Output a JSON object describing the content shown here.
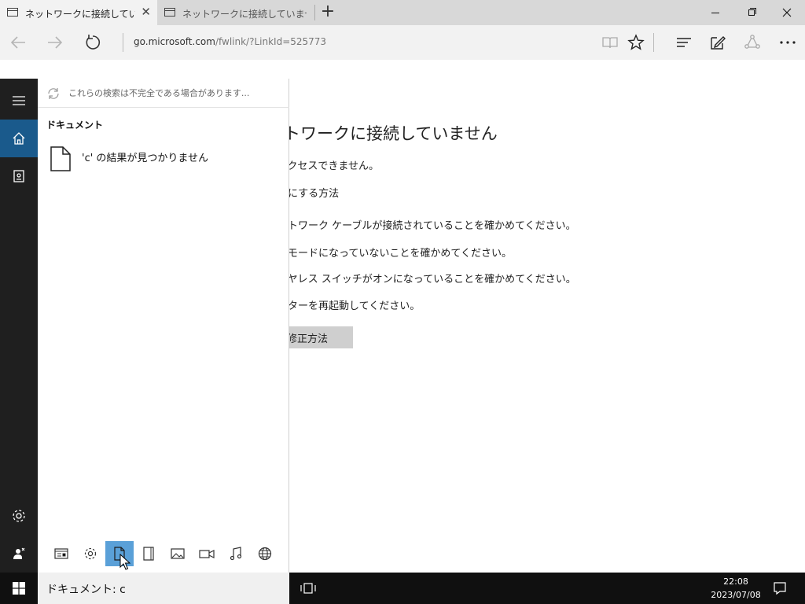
{
  "browser": {
    "tabs": [
      {
        "title": "ネットワークに接続していませ",
        "close": "✕",
        "icon": "page-icon",
        "active": true
      },
      {
        "title": "ネットワークに接続していません",
        "icon": "page-icon",
        "active": false
      }
    ],
    "new_tab": "+",
    "address": {
      "host": "go.microsoft.com",
      "path": "/fwlink/?LinkId=525773"
    },
    "nav_icons": [
      "back-icon",
      "forward-icon",
      "refresh-icon"
    ],
    "toolbar_icons": [
      "reading-view-icon",
      "favorite-star-icon",
      "hub-icon",
      "web-note-icon",
      "share-icon",
      "more-icon"
    ],
    "window_controls": [
      "minimize-icon",
      "restore-icon",
      "close-icon"
    ]
  },
  "page": {
    "title": "ットワークに接続していません",
    "lines": [
      "にアクセスできません。",
      "インにする方法",
      "ネットワーク ケーブルが接続されていることを確かめてください。",
      "機内モードになっていないことを確かめてください。",
      "ワイヤレス スイッチがオンになっていることを確かめてください。",
      "ルーターを再起動してください。"
    ],
    "fix_button": "修正方法"
  },
  "start_rail": {
    "items": [
      "menu-icon",
      "home-icon",
      "notebook-icon",
      "settings-icon",
      "feedback-icon"
    ]
  },
  "search_panel": {
    "notice": "これらの検索は不完全である場合があります...",
    "section": "ドキュメント",
    "result": "'c' の結果が見つかりません",
    "filters": [
      "apps-icon",
      "settings-icon",
      "documents-icon",
      "folders-icon",
      "photos-icon",
      "videos-icon",
      "music-icon",
      "web-icon"
    ],
    "active_filter": "documents-icon"
  },
  "taskbar": {
    "search_text": "ドキュメント: c",
    "time": "22:08",
    "date": "2023/07/08"
  },
  "colors": {
    "rail_bg": "#1f1f1f",
    "rail_active": "#1a5a8c",
    "filter_active": "#5aa0d8",
    "taskbar_bg": "#101010"
  }
}
